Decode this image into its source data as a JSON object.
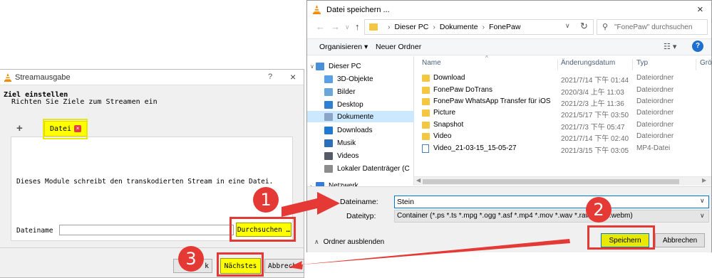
{
  "vlc": {
    "title": "Streamausgabe",
    "help": "?",
    "close": "×",
    "heading": "Ziel einstellen",
    "subheading": "Richten Sie Ziele zum Streamen ein",
    "tab_plus": "+",
    "tab_label": "Datei",
    "tab_close": "×",
    "description": "Dieses Module schreibt den transkodierten Stream in eine Datei.",
    "filename_label": "Dateiname",
    "filename_value": "",
    "browse_label": "Durchsuchen …",
    "back_label": "k",
    "next_label": "Nächstes",
    "cancel_label": "Abbrech"
  },
  "save": {
    "title": "Datei speichern ...",
    "close": "×",
    "path": [
      "Dieser PC",
      "Dokumente",
      "FonePaw"
    ],
    "search_placeholder": "\"FonePaw\" durchsuchen",
    "organize": "Organisieren ▾",
    "new_folder": "Neuer Ordner",
    "nav": [
      {
        "label": "Dieser PC",
        "icon": "pc-icon",
        "color": "#4a90d9"
      },
      {
        "label": "3D-Objekte",
        "icon": "3d-objects-icon",
        "color": "#5aa0e6"
      },
      {
        "label": "Bilder",
        "icon": "pictures-icon",
        "color": "#6aa7d8"
      },
      {
        "label": "Desktop",
        "icon": "desktop-icon",
        "color": "#2f80d1"
      },
      {
        "label": "Dokumente",
        "icon": "documents-icon",
        "color": "#8aa5c8"
      },
      {
        "label": "Downloads",
        "icon": "downloads-icon",
        "color": "#1f78d1"
      },
      {
        "label": "Musik",
        "icon": "music-icon",
        "color": "#2a6fb8"
      },
      {
        "label": "Videos",
        "icon": "videos-icon",
        "color": "#555a66"
      },
      {
        "label": "Lokaler Datenträger (C",
        "icon": "drive-icon",
        "color": "#8c8c8c"
      },
      {
        "label": "Netzwerk",
        "icon": "network-icon",
        "color": "#3a7bd5"
      }
    ],
    "columns": {
      "name": "Name",
      "date": "Änderungsdatum",
      "type": "Typ",
      "size": "Grö"
    },
    "files": [
      {
        "name": "Download",
        "date": "2021/7/14 下午 01:44",
        "type": "Dateiordner",
        "kind": "folder"
      },
      {
        "name": "FonePaw DoTrans",
        "date": "2020/3/4 上午 11:03",
        "type": "Dateiordner",
        "kind": "folder"
      },
      {
        "name": "FonePaw WhatsApp Transfer für iOS",
        "date": "2021/2/3 上午 11:36",
        "type": "Dateiordner",
        "kind": "folder"
      },
      {
        "name": "Picture",
        "date": "2021/5/17 下午 03:50",
        "type": "Dateiordner",
        "kind": "folder"
      },
      {
        "name": "Snapshot",
        "date": "2021/7/3 下午 05:47",
        "type": "Dateiordner",
        "kind": "folder"
      },
      {
        "name": "Video",
        "date": "2021/7/14 下午 02:40",
        "type": "Dateiordner",
        "kind": "folder"
      },
      {
        "name": "Video_21-03-15_15-05-27",
        "date": "2021/3/15 下午 03:05",
        "type": "MP4-Datei",
        "kind": "video"
      }
    ],
    "filename_label": "Dateiname:",
    "filename_value": "Stein",
    "filetype_label": "Dateityp:",
    "filetype_value": "Container (*.ps *.ts *.mpg *.ogg *.asf *.mp4 *.mov *.wav *.raw *.flv *.webm)",
    "hide_folders": "Ordner ausblenden",
    "save_label": "Speichern",
    "cancel_label": "Abbrechen"
  },
  "annotations": {
    "badges": [
      "1",
      "2",
      "3"
    ],
    "highlight_color": "#ffff00",
    "annotation_color": "#e53935"
  }
}
